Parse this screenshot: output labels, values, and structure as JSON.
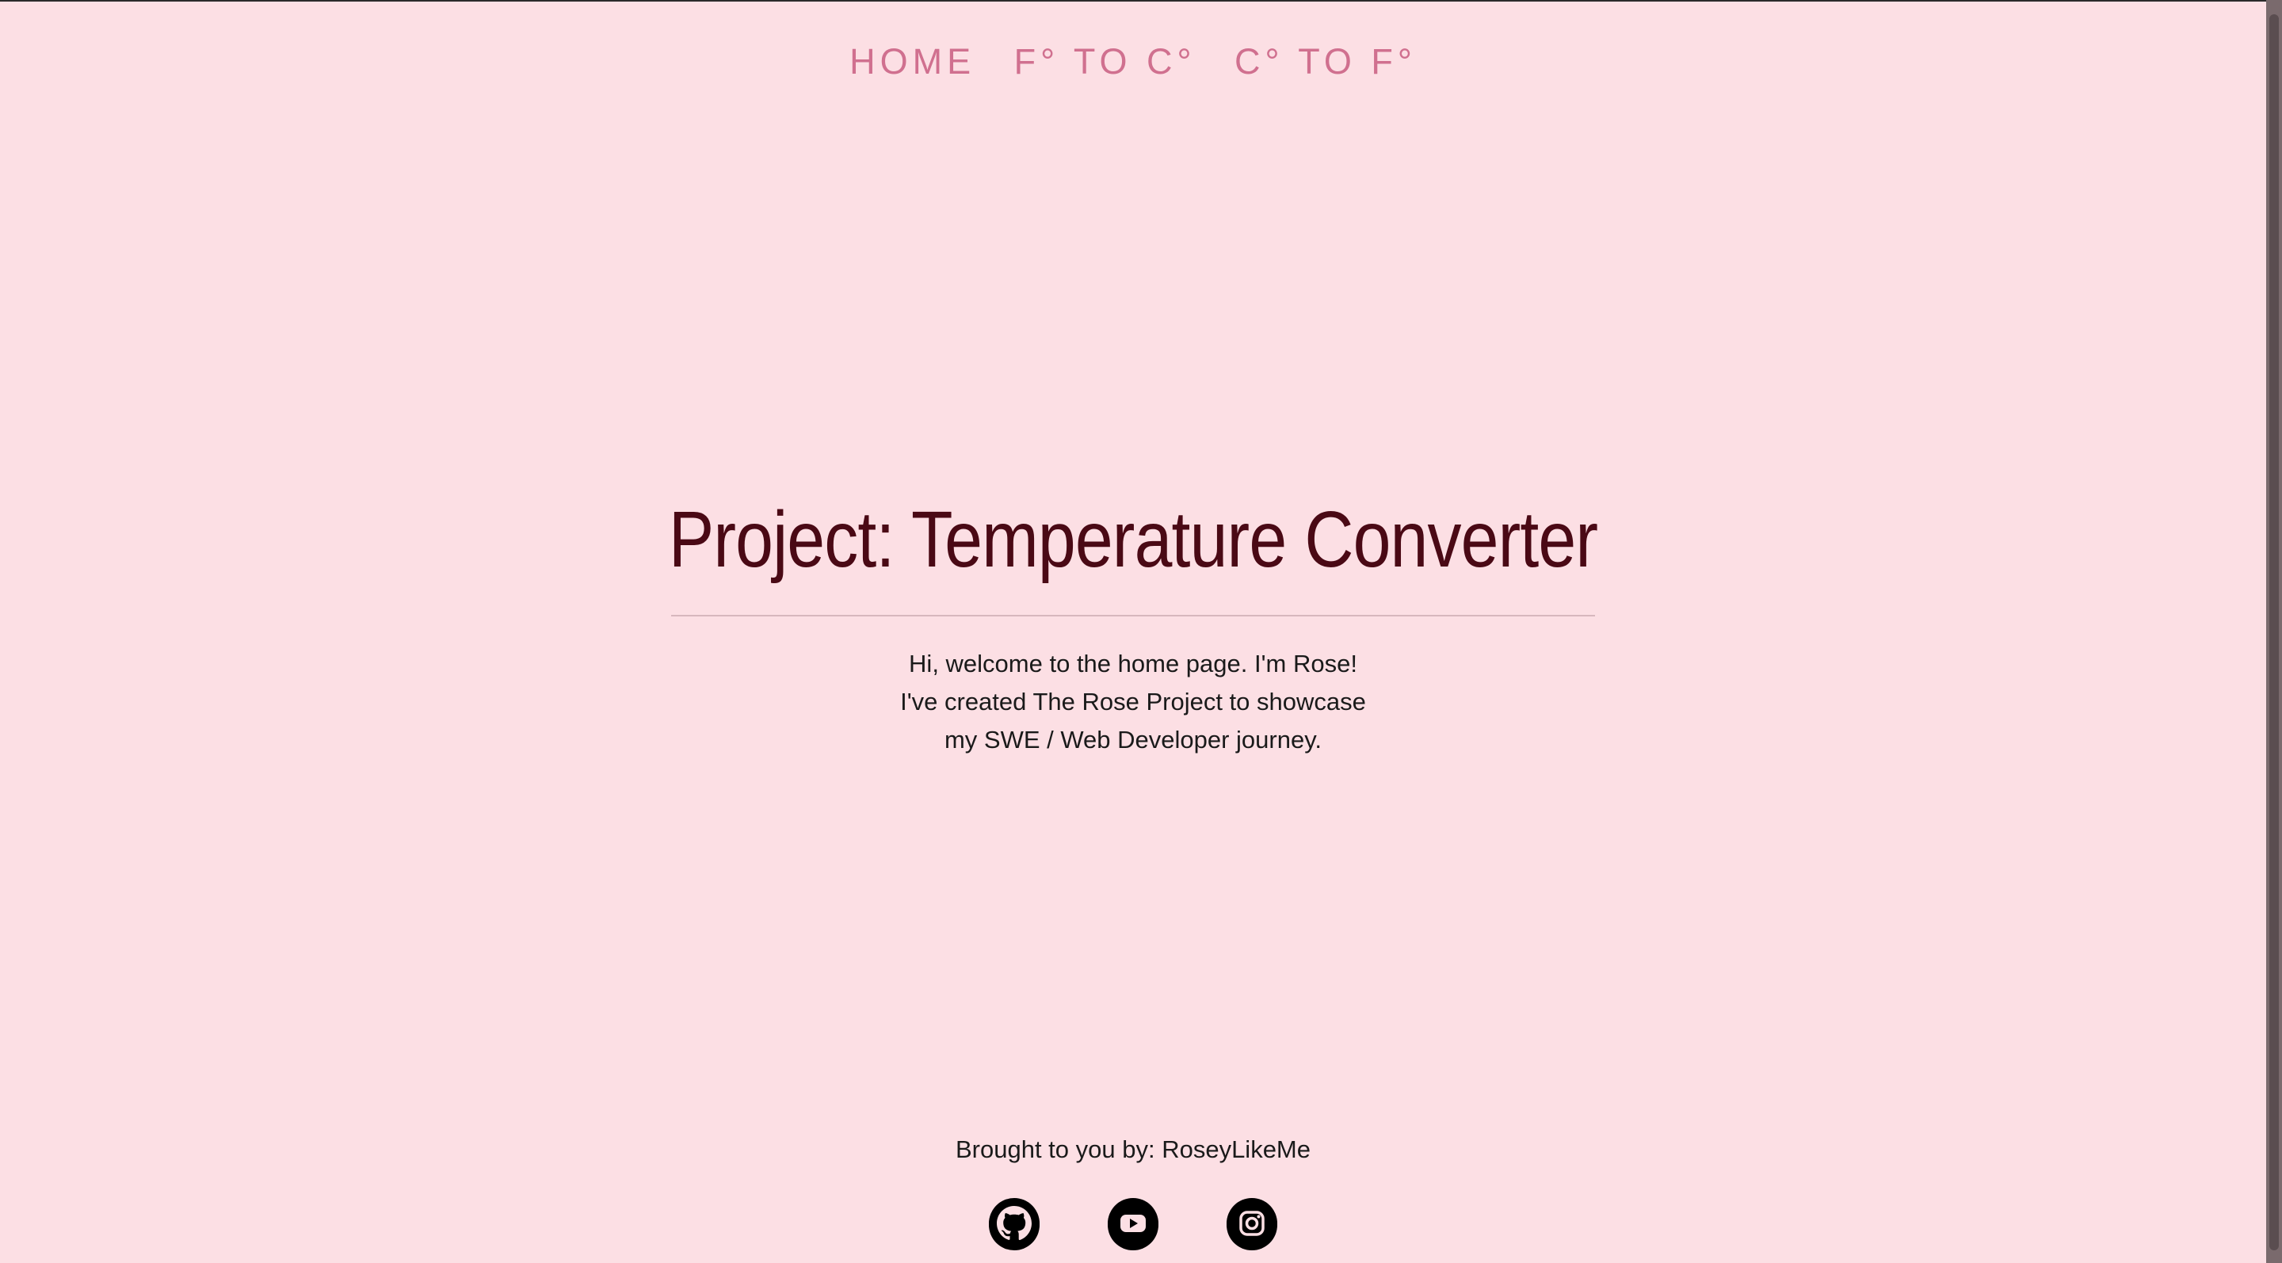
{
  "nav": {
    "items": [
      {
        "label": "HOME"
      },
      {
        "label": "F° TO C°"
      },
      {
        "label": "C° TO F°"
      }
    ]
  },
  "hero": {
    "title": "Project: Temperature Converter",
    "lines": [
      "Hi, welcome to the home page. I'm Rose!",
      "I've created The Rose Project to showcase",
      "my SWE / Web Developer journey."
    ]
  },
  "footer": {
    "credit": "Brought to you by: RoseyLikeMe",
    "socials": [
      {
        "icon": "github-icon"
      },
      {
        "icon": "youtube-icon"
      },
      {
        "icon": "instagram-icon"
      }
    ]
  },
  "colors": {
    "background": "#fcdfe4",
    "nav": "#d0708f",
    "title": "#4a0915",
    "text": "#1a1a1a"
  }
}
